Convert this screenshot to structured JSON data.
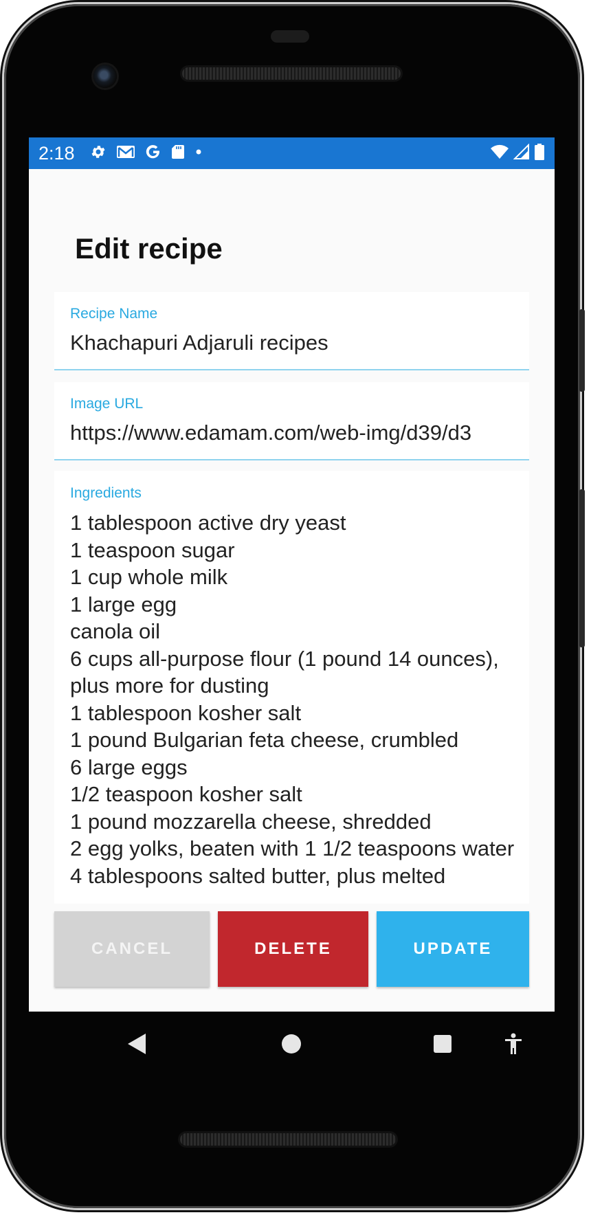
{
  "status_bar": {
    "time": "2:18",
    "left_icons": [
      "gear-icon",
      "gmail-icon",
      "google-icon",
      "sd-card-icon",
      "dot-icon"
    ],
    "right_icons": [
      "wifi-icon",
      "signal-icon",
      "battery-icon"
    ],
    "background": "#1976d2"
  },
  "page": {
    "title": "Edit recipe"
  },
  "form": {
    "recipe_name": {
      "label": "Recipe Name",
      "value": "Khachapuri Adjaruli recipes"
    },
    "image_url": {
      "label": "Image URL",
      "value": "https://www.edamam.com/web-img/d39/d3"
    },
    "ingredients": {
      "label": "Ingredients",
      "value": "1 tablespoon active dry yeast\n1 teaspoon sugar\n1 cup whole milk\n1 large egg\ncanola oil\n6 cups all-purpose flour (1 pound 14 ounces), plus more for dusting\n1 tablespoon kosher salt\n1 pound Bulgarian feta cheese, crumbled\n6 large eggs\n1/2 teaspoon kosher salt\n1 pound mozzarella cheese, shredded\n2 egg yolks, beaten with 1 1/2 teaspoons water\n4 tablespoons salted butter, plus melted"
    },
    "accent_color": "#29a9e0"
  },
  "buttons": {
    "cancel": "CANCEL",
    "delete": "DELETE",
    "update": "UPDATE",
    "colors": {
      "cancel": "#d3d3d3",
      "delete": "#c1272d",
      "update": "#2fb2ec"
    }
  },
  "nav_bar": {
    "items": [
      "back-icon",
      "home-icon",
      "recents-icon",
      "accessibility-icon"
    ]
  }
}
